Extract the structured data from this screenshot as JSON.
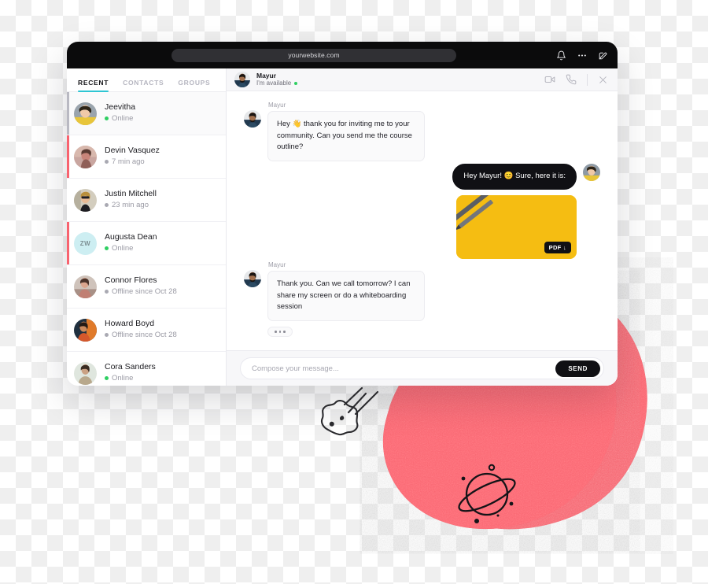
{
  "browser": {
    "url": "yourwebsite.com",
    "icons": [
      "bell-icon",
      "more-dots-icon",
      "compose-icon"
    ]
  },
  "sidebar": {
    "tabs": [
      {
        "label": "RECENT",
        "active": true
      },
      {
        "label": "CONTACTS",
        "active": false
      },
      {
        "label": "GROUPS",
        "active": false
      }
    ],
    "contacts": [
      {
        "name": "Jeevitha",
        "status": "Online",
        "online": true,
        "state": "selected",
        "avatar": "photo-woman-yellow",
        "initials": ""
      },
      {
        "name": "Devin Vasquez",
        "status": "7 min ago",
        "online": false,
        "state": "unread",
        "avatar": "photo-person-sunset",
        "initials": ""
      },
      {
        "name": "Justin Mitchell",
        "status": "23 min ago",
        "online": false,
        "state": "none",
        "avatar": "photo-woman-shades",
        "initials": ""
      },
      {
        "name": "Augusta Dean",
        "status": "Online",
        "online": true,
        "state": "unread",
        "avatar": "initials",
        "initials": "ZW"
      },
      {
        "name": "Connor Flores",
        "status": "Offline since Oct 28",
        "online": false,
        "state": "none",
        "avatar": "photo-person-dress",
        "initials": ""
      },
      {
        "name": "Howard Boyd",
        "status": "Offline since Oct 28",
        "online": false,
        "state": "none",
        "avatar": "photo-person-orange",
        "initials": ""
      },
      {
        "name": "Cora Sanders",
        "status": "Online",
        "online": true,
        "state": "none",
        "avatar": "photo-person-coat",
        "initials": ""
      }
    ]
  },
  "chat": {
    "header": {
      "name": "Mayur",
      "status": "I'm available",
      "actions": [
        "video-call-icon",
        "phone-call-icon",
        "close-icon"
      ]
    },
    "messages": [
      {
        "sender": "Mayur",
        "direction": "in",
        "text": "Hey 👋 thank you for inviting me to your community. Can you send me the course outline?"
      },
      {
        "sender": "",
        "direction": "out",
        "text": "Hey Mayur! 😊 Sure, here it is:",
        "attachment": {
          "type": "PDF",
          "badge": "PDF ↓"
        }
      },
      {
        "sender": "Mayur",
        "direction": "in",
        "text": "Thank you. Can we call tomorrow? I can share my screen or do a whiteboarding session",
        "typing": true
      }
    ]
  },
  "composer": {
    "placeholder": "Compose your message...",
    "value": "",
    "send_label": "SEND"
  },
  "colors": {
    "accent_teal": "#2ec5d3",
    "unread_red": "#f8636f",
    "online_green": "#2fcf62",
    "dark": "#101014",
    "blob_pink": "#f8636f",
    "attachment_yellow": "#f5bd12",
    "initials_bg": "#cdeef2"
  }
}
